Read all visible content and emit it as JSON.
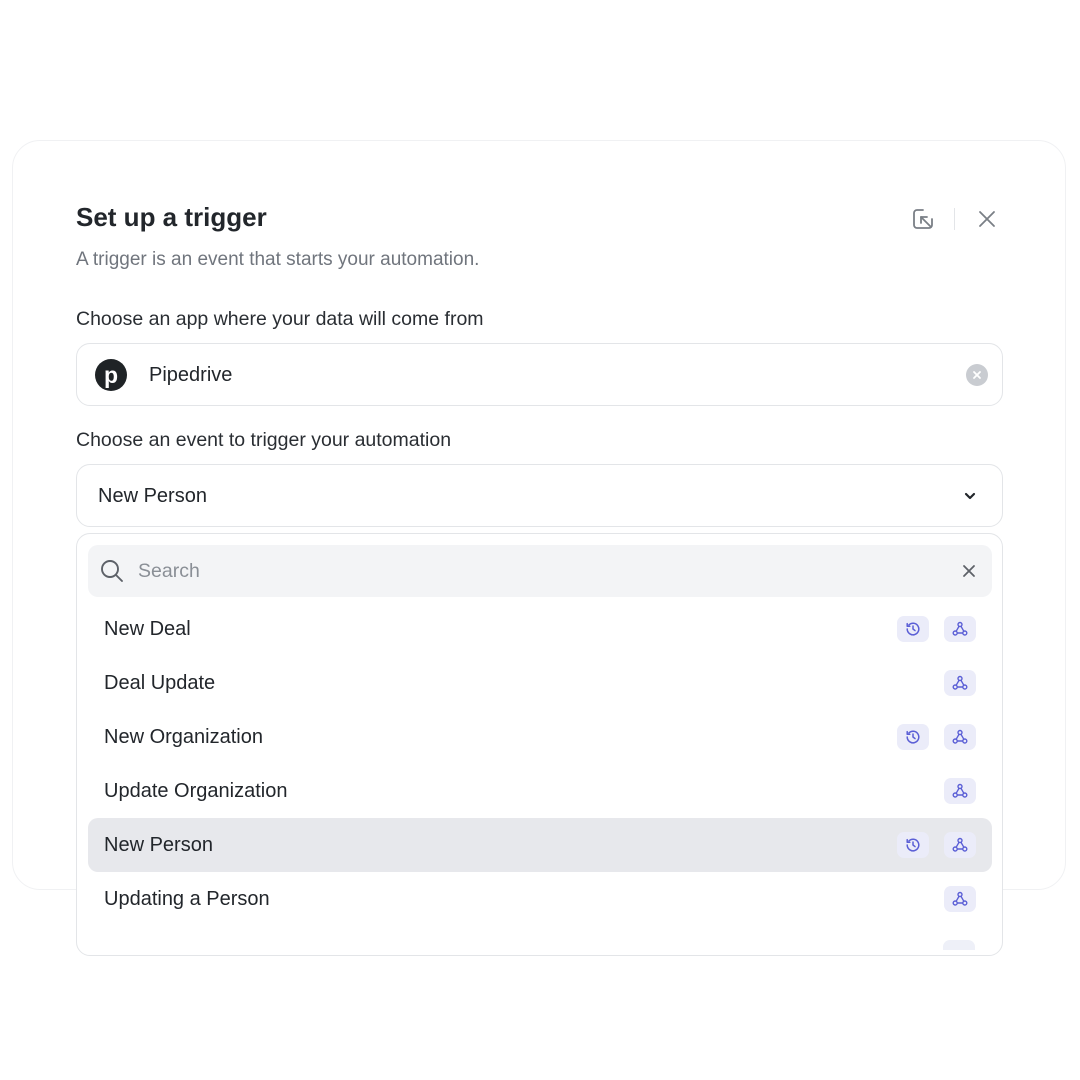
{
  "dialog": {
    "title": "Set up a trigger",
    "subtitle": "A trigger is an event that starts your automation."
  },
  "app_select": {
    "label": "Choose an app where your data will come from",
    "value": "Pipedrive",
    "logo_letter": "p",
    "logo_icon": "pipedrive-logo-icon"
  },
  "event_select": {
    "label": "Choose an event to trigger your automation",
    "value": "New Person"
  },
  "dropdown": {
    "search_placeholder": "Search",
    "items": [
      {
        "label": "New Deal",
        "history": true,
        "webhook": true,
        "selected": false
      },
      {
        "label": "Deal Update",
        "history": false,
        "webhook": true,
        "selected": false
      },
      {
        "label": "New Organization",
        "history": true,
        "webhook": true,
        "selected": false
      },
      {
        "label": "Update Organization",
        "history": false,
        "webhook": true,
        "selected": false
      },
      {
        "label": "New Person",
        "history": true,
        "webhook": true,
        "selected": true
      },
      {
        "label": "Updating a Person",
        "history": false,
        "webhook": true,
        "selected": false
      }
    ]
  },
  "icons": {
    "minimize": "minimize-to-corner-icon",
    "close": "close-icon",
    "clear": "clear-circle-icon",
    "chevron": "chevron-down-icon",
    "search": "search-icon",
    "history": "history-clock-icon",
    "webhook": "webhook-icon"
  },
  "colors": {
    "badge_bg": "#ebecf9",
    "badge_icon": "#5b5fd6",
    "selected_row": "#e7e8ec",
    "logo_bg": "#1f2326"
  }
}
